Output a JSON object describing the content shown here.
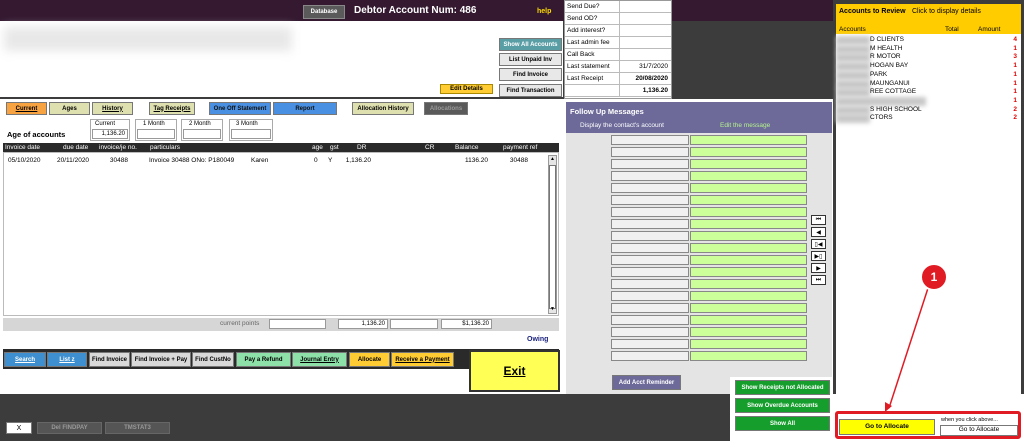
{
  "header": {
    "database_btn": "Database",
    "title_prefix": "Debtor Account Num:",
    "account_num": "486",
    "help": "help"
  },
  "info_panel": {
    "rows": [
      {
        "label": "Send Due?",
        "value": ""
      },
      {
        "label": "Send OD?",
        "value": ""
      },
      {
        "label": "Add interest?",
        "value": ""
      },
      {
        "label": "Last admin fee",
        "value": ""
      },
      {
        "label": "Call Back",
        "value": ""
      },
      {
        "label": "Last statement",
        "value": "31/7/2020"
      },
      {
        "label": "Last Receipt",
        "value": "20/08/2020"
      },
      {
        "label": "",
        "value": "1,136.20"
      }
    ]
  },
  "side_buttons": {
    "show_all": "Show All Accounts",
    "list_unpaid": "List Unpaid Inv",
    "find_invoice": "Find Invoice",
    "find_transaction": "Find Transaction"
  },
  "edit_details": "Edit Details",
  "tabs": {
    "current": "Current",
    "ages": "Ages",
    "history": "History",
    "tag_receipts": "Tag Receipts",
    "one_off": "One Off Statement",
    "report": "Report",
    "allocation_history": "Allocation History",
    "allocations": "Allocations"
  },
  "aging": {
    "title": "Age of accounts",
    "current_label": "Current",
    "current_value": "1,136.20",
    "m1": "1 Month",
    "m2": "2 Month",
    "m3": "3 Month"
  },
  "table": {
    "headers": [
      "Invoice date",
      "due date",
      "invoice/je no.",
      "particulars",
      "age",
      "gst",
      "DR",
      "CR",
      "Balance",
      "payment ref"
    ],
    "rows": [
      {
        "invoice_date": "05/10/2020",
        "due_date": "20/11/2020",
        "inv_no": "30488",
        "particulars": "Invoice 30488 ONo: P180049",
        "person": "Karen",
        "age": "0",
        "gst": "Y",
        "dr": "1,136.20",
        "cr": "",
        "balance": "1136.20",
        "payment_ref": "30488"
      }
    ]
  },
  "totals": {
    "current_points_label": "current points",
    "dr_total": "1,136.20",
    "balance_total": "$1,136.20",
    "owing": "Owing"
  },
  "bottom_buttons": {
    "search": "Search",
    "list": "List z",
    "find_invoice": "Find Invoice",
    "find_invoice_pay": "Find Invoice + Pay",
    "find_custno": "Find CustNo",
    "pay_refund": "Pay a Refund",
    "journal_entry": "Journal Entry",
    "allocate": "Allocate",
    "receive_payment": "Receive a Payment",
    "exit": "Exit"
  },
  "footer_buttons": {
    "x": "X",
    "del_findpay": "Del FINDPAY",
    "tmstat": "TMSTAT3"
  },
  "follow_up": {
    "title": "Follow Up Messages",
    "col1": "Display the contact's account",
    "col2": "Edit the message",
    "row_count": 19,
    "add_reminder": "Add Acct Reminder"
  },
  "review": {
    "title": "Accounts to Review",
    "subtitle": "Click to display details",
    "col_accounts": "Accounts",
    "col_total": "Total",
    "col_amount": "Amount",
    "rows": [
      {
        "name": "D CLIENTS",
        "amount": "4"
      },
      {
        "name": "M HEALTH",
        "amount": "1"
      },
      {
        "name": "R MOTOR",
        "amount": "3"
      },
      {
        "name": "HOGAN BAY",
        "amount": "1"
      },
      {
        "name": "PARK",
        "amount": "1"
      },
      {
        "name": "MAUNGANUI",
        "amount": "1"
      },
      {
        "name": "REE COTTAGE",
        "amount": "1"
      },
      {
        "name": "",
        "amount": "1"
      },
      {
        "name": "S HIGH SCHOOL",
        "amount": "2"
      },
      {
        "name": "CTORS",
        "amount": "2"
      }
    ]
  },
  "lower_right": {
    "show_receipts": "Show Receipts not Allocated",
    "show_overdue": "Show Overdue Accounts",
    "show_all": "Show All",
    "goto_allocate_yellow": "Go to Allocate",
    "hint": "when you click above...",
    "goto_allocate_white": "Go to Allocate",
    "badge": "1"
  },
  "colors": {
    "header_bg": "#341930",
    "annotation_red": "#e01b24",
    "lime": "#ccff99",
    "purple_panel": "#6d6a9a"
  }
}
